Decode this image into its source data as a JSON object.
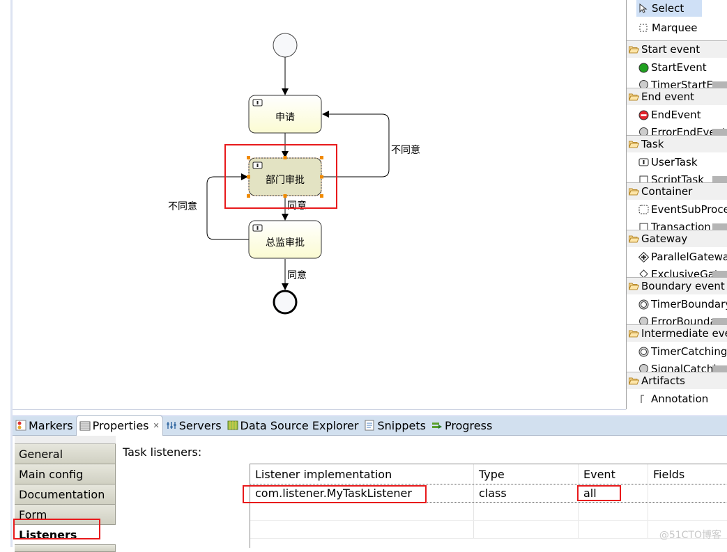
{
  "diagram": {
    "tasks": [
      {
        "id": "apply",
        "label": "申请"
      },
      {
        "id": "dept",
        "label": "部门审批",
        "selected": true
      },
      {
        "id": "director",
        "label": "总监审批"
      }
    ],
    "flows": [
      {
        "from": "start",
        "to": "apply",
        "label": ""
      },
      {
        "from": "apply",
        "to": "dept",
        "label": ""
      },
      {
        "from": "dept",
        "to": "apply",
        "label": "不同意"
      },
      {
        "from": "dept",
        "to": "director",
        "label": "同意"
      },
      {
        "from": "director",
        "to": "dept",
        "label": "不同意"
      },
      {
        "from": "director",
        "to": "end",
        "label": "同意"
      }
    ]
  },
  "palette": {
    "tools": [
      {
        "label": "Select",
        "icon": "cursor-arrow-icon",
        "selected": true
      },
      {
        "label": "Marquee",
        "icon": "marquee-icon"
      }
    ],
    "groups": [
      {
        "label": "Start event",
        "item": "StartEvent",
        "icon": "start-event-icon",
        "partial": "TimerStartEvent"
      },
      {
        "label": "End event",
        "item": "EndEvent",
        "icon": "end-event-icon",
        "partial": "ErrorEndEvent"
      },
      {
        "label": "Task",
        "item": "UserTask",
        "icon": "user-task-icon",
        "partial": "ScriptTask"
      },
      {
        "label": "Container",
        "item": "EventSubProcess",
        "icon": "event-subprocess-icon",
        "partial": "Transaction"
      },
      {
        "label": "Gateway",
        "item": "ParallelGateway",
        "icon": "parallel-gateway-icon",
        "partial": "ExclusiveGateway"
      },
      {
        "label": "Boundary event",
        "item": "TimerBoundaryEvent",
        "icon": "timer-icon",
        "partial": "ErrorBoundaryEvent"
      },
      {
        "label": "Intermediate event",
        "item": "TimerCatchingEvent",
        "icon": "timer-icon",
        "partial": "SignalCatchingEvent"
      },
      {
        "label": "Artifacts",
        "item": "Annotation",
        "icon": "annotation-icon",
        "partial": ""
      }
    ]
  },
  "bottom_tabs": [
    {
      "label": "Markers",
      "icon": "markers-icon"
    },
    {
      "label": "Properties",
      "icon": "properties-icon",
      "active": true
    },
    {
      "label": "Servers",
      "icon": "servers-icon"
    },
    {
      "label": "Data Source Explorer",
      "icon": "data-source-icon"
    },
    {
      "label": "Snippets",
      "icon": "snippets-icon"
    },
    {
      "label": "Progress",
      "icon": "progress-icon"
    }
  ],
  "properties": {
    "side_tabs": [
      "General",
      "Main config",
      "Documentation",
      "Form",
      "Listeners"
    ],
    "selected_side_tab": "Listeners",
    "section_title": "Task listeners:",
    "table": {
      "columns": [
        "Listener implementation",
        "Type",
        "Event",
        "Fields"
      ],
      "rows": [
        [
          "com.listener.MyTaskListener",
          "class",
          "all",
          ""
        ]
      ]
    }
  },
  "watermark": "@51CTO博客",
  "colors": {
    "highlight_red": "#e8191b",
    "task_fill": "#fdfde6",
    "task_selected_fill": "#e3e3c3",
    "handle_orange": "#f08a00",
    "start_event_green": "#1f9b1f",
    "end_event_red": "#e2262e"
  }
}
